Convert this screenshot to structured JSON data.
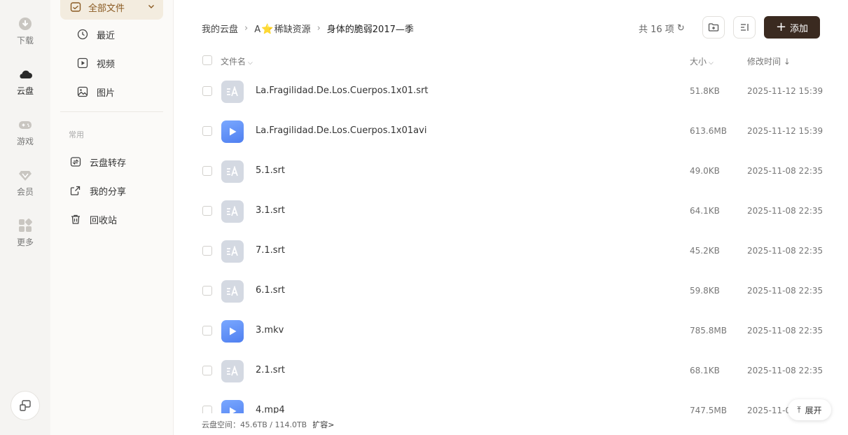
{
  "rail": {
    "items": [
      {
        "label": "下载",
        "icon": "download-icon"
      },
      {
        "label": "云盘",
        "icon": "cloud-icon"
      },
      {
        "label": "游戏",
        "icon": "gamepad-icon"
      },
      {
        "label": "会员",
        "icon": "diamond-icon"
      },
      {
        "label": "更多",
        "icon": "apps-grid-icon"
      }
    ],
    "bottom_icon": "switch-device-icon"
  },
  "sidebar": {
    "all_files": "全部文件",
    "items": [
      {
        "label": "最近",
        "icon": "clock-icon"
      },
      {
        "label": "视频",
        "icon": "play-square-icon"
      },
      {
        "label": "图片",
        "icon": "image-icon"
      }
    ],
    "section_label": "常用",
    "common": [
      {
        "label": "云盘转存",
        "icon": "transfer-icon"
      },
      {
        "label": "我的分享",
        "icon": "share-icon"
      },
      {
        "label": "回收站",
        "icon": "trash-icon"
      }
    ]
  },
  "breadcrumb": {
    "root": "我的云盘",
    "middle_prefix": "A",
    "middle_suffix": "稀缺资源",
    "current": "身体的脆弱2017—季"
  },
  "toolbar": {
    "count": "共 16 项",
    "add_label": "添加"
  },
  "table": {
    "col_name": "文件名",
    "col_size": "大小",
    "col_time": "修改时间 ↓",
    "rows": [
      {
        "type": "srt",
        "name": "La.Fragilidad.De.Los.Cuerpos.1x01.srt",
        "size": "51.8KB",
        "time": "2025-11-12 15:39"
      },
      {
        "type": "vid",
        "name": "La.Fragilidad.De.Los.Cuerpos.1x01avi",
        "size": "613.6MB",
        "time": "2025-11-12 15:39"
      },
      {
        "type": "srt",
        "name": "5.1.srt",
        "size": "49.0KB",
        "time": "2025-11-08 22:35"
      },
      {
        "type": "srt",
        "name": "3.1.srt",
        "size": "64.1KB",
        "time": "2025-11-08 22:35"
      },
      {
        "type": "srt",
        "name": "7.1.srt",
        "size": "45.2KB",
        "time": "2025-11-08 22:35"
      },
      {
        "type": "srt",
        "name": "6.1.srt",
        "size": "59.8KB",
        "time": "2025-11-08 22:35"
      },
      {
        "type": "vid",
        "name": "3.mkv",
        "size": "785.8MB",
        "time": "2025-11-08 22:35"
      },
      {
        "type": "srt",
        "name": "2.1.srt",
        "size": "68.1KB",
        "time": "2025-11-08 22:35"
      },
      {
        "type": "vid",
        "name": "4.mp4",
        "size": "747.5MB",
        "time": "2025-11-0"
      }
    ]
  },
  "footer": {
    "storage": "云盘空间：45.6TB / 114.0TB",
    "expand_link": "扩容>",
    "expand_pill": "展开"
  },
  "colors": {
    "accent_dark": "#3a2a20",
    "active_tab_bg": "#f3ecdf",
    "video_icon": "#5b8cf5"
  }
}
